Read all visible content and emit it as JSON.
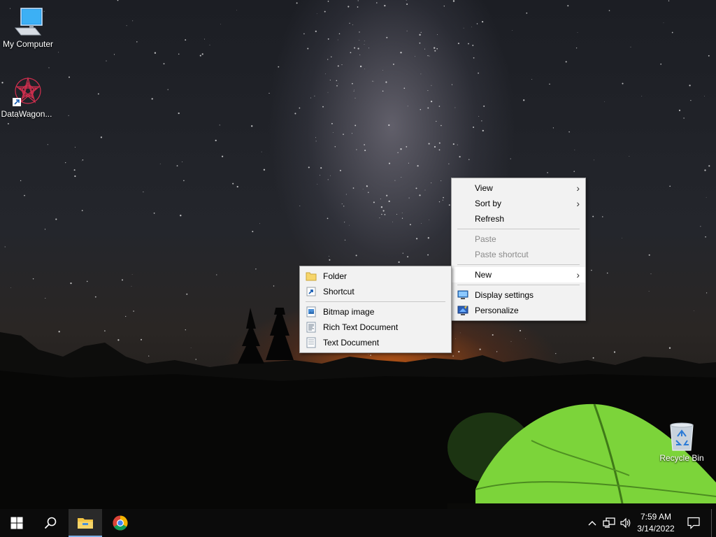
{
  "desktop_icons": [
    {
      "label": "My Computer",
      "icon": "computer-icon"
    },
    {
      "label": "DataWagon...",
      "icon": "datawagon-shortcut-icon"
    },
    {
      "label": "Recycle Bin",
      "icon": "recycle-bin-icon"
    }
  ],
  "context_menu": {
    "items": [
      {
        "label": "View",
        "submenu": true
      },
      {
        "label": "Sort by",
        "submenu": true
      },
      {
        "label": "Refresh"
      },
      {
        "label": "Paste",
        "disabled": true
      },
      {
        "label": "Paste shortcut",
        "disabled": true
      },
      {
        "label": "New",
        "submenu": true,
        "active": true
      },
      {
        "label": "Display settings",
        "icon": "display-icon"
      },
      {
        "label": "Personalize",
        "icon": "personalize-icon"
      }
    ]
  },
  "new_submenu": {
    "items": [
      {
        "label": "Folder",
        "icon": "folder-icon"
      },
      {
        "label": "Shortcut",
        "icon": "shortcut-icon"
      },
      {
        "label": "Bitmap image",
        "icon": "bitmap-icon"
      },
      {
        "label": "Rich Text Document",
        "icon": "rich-text-icon"
      },
      {
        "label": "Text Document",
        "icon": "text-document-icon"
      }
    ]
  },
  "taskbar": {
    "pinned": [
      "start-icon",
      "search-icon",
      "file-explorer-icon",
      "chrome-icon"
    ],
    "active_app": "file-explorer-icon",
    "clock": {
      "time": "7:59 AM",
      "date": "3/14/2022"
    },
    "tray": [
      "show-hidden-icons-chevron",
      "network-icon",
      "volume-icon",
      "notifications-icon"
    ]
  },
  "colors": {
    "accent": "#7fb2e8",
    "menu_bg": "#f2f2f2",
    "taskbar_bg": "#0b0b0b"
  }
}
